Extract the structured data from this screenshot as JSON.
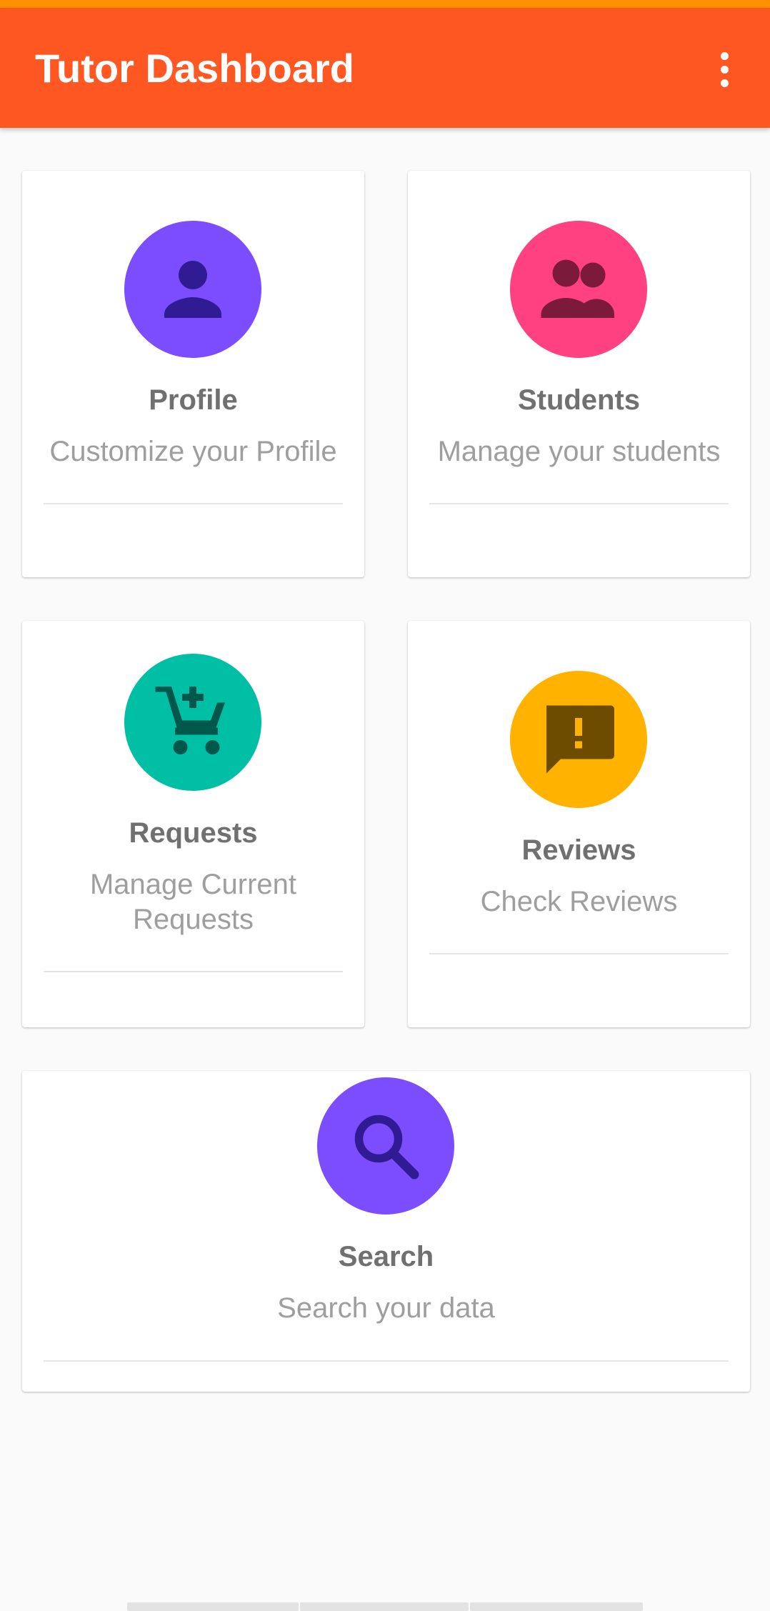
{
  "app_bar": {
    "title": "Tutor Dashboard",
    "menu_icon": "more-vert-icon",
    "background": "#ff5722",
    "status_strip_color": "#ff9100"
  },
  "cards": {
    "profile": {
      "title": "Profile",
      "subtitle": "Customize your Profile",
      "icon": "person-icon",
      "icon_bg": "#7c4dff"
    },
    "students": {
      "title": "Students",
      "subtitle": "Manage your students",
      "icon": "people-icon",
      "icon_bg": "#ff4081"
    },
    "requests": {
      "title": "Requests",
      "subtitle_line1": "Manage Current",
      "subtitle_line2": "Requests",
      "icon": "add-shopping-cart-icon",
      "icon_bg": "#00bfa5"
    },
    "reviews": {
      "title": "Reviews",
      "subtitle": "Check Reviews",
      "icon": "feedback-icon",
      "icon_bg": "#ffb300"
    },
    "search": {
      "title": "Search",
      "subtitle": "Search your data",
      "icon": "search-icon",
      "icon_bg": "#7c4dff"
    }
  }
}
